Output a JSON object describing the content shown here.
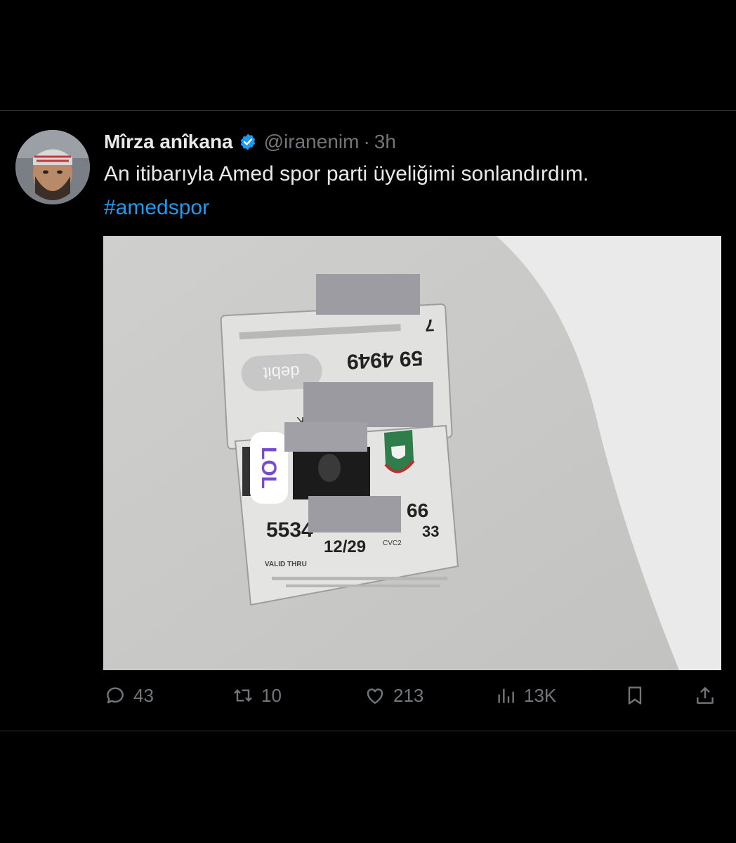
{
  "tweet": {
    "author": {
      "display_name": "Mîrza anîkana",
      "handle": "@iranenim",
      "verified": true
    },
    "separator": "·",
    "time": "3h",
    "text": "An itibarıyla Amed spor parti üyeliğimi sonlandırdım.",
    "hashtag": "#amedspor"
  },
  "card": {
    "debit_label": "debit",
    "number_top": "59 4949",
    "number_top_digit": "7",
    "number_main": "5534",
    "number_main_end": "66",
    "cvc_value": "33",
    "expiry": "12/29",
    "cvc_label": "CVC2",
    "valid_thru": "VALID THRU",
    "sticker_text": "LOL",
    "side_letter": "K"
  },
  "actions": {
    "reply_count": "43",
    "retweet_count": "10",
    "like_count": "213",
    "view_count": "13K"
  },
  "colors": {
    "background": "#000000",
    "text_primary": "#e7e9ea",
    "text_secondary": "#71767b",
    "link": "#1d9bf0",
    "verified": "#1d9bf0"
  }
}
